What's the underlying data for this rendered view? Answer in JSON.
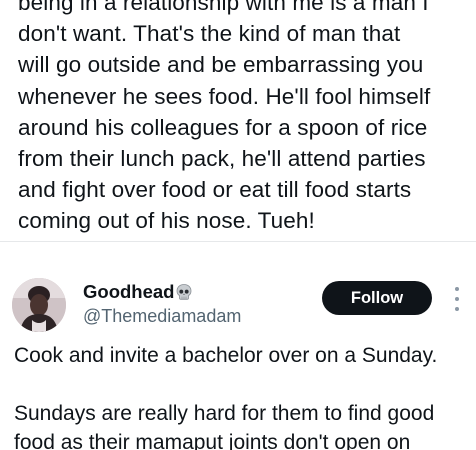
{
  "previous_post": {
    "lines": [
      "being in a relationship with me is a man I",
      "don't want. That's the kind of man that",
      "will go outside and be embarrassing you",
      "whenever he sees food. He'll fool himself",
      "around his colleagues for a spoon of rice",
      "from their lunch pack, he'll attend parties",
      "and fight over food or eat till food starts",
      "coming out of his nose. Tueh!"
    ]
  },
  "post": {
    "author_name": "Goodhead",
    "author_emoji_icon": "skull-icon",
    "author_handle": "@Themediamadam",
    "follow_label": "Follow",
    "more_icon": "more-vertical-icon",
    "body_lines": [
      "Cook and invite a bachelor over on a Sunday.",
      "Sundays are really hard for them to find good",
      "food as their mamaput joints don't open on"
    ]
  },
  "colors": {
    "text": "#0f1419",
    "secondary_text": "#536471",
    "follow_button_bg": "#0f1419",
    "follow_button_text": "#ffffff",
    "divider": "#e6e8ea"
  }
}
